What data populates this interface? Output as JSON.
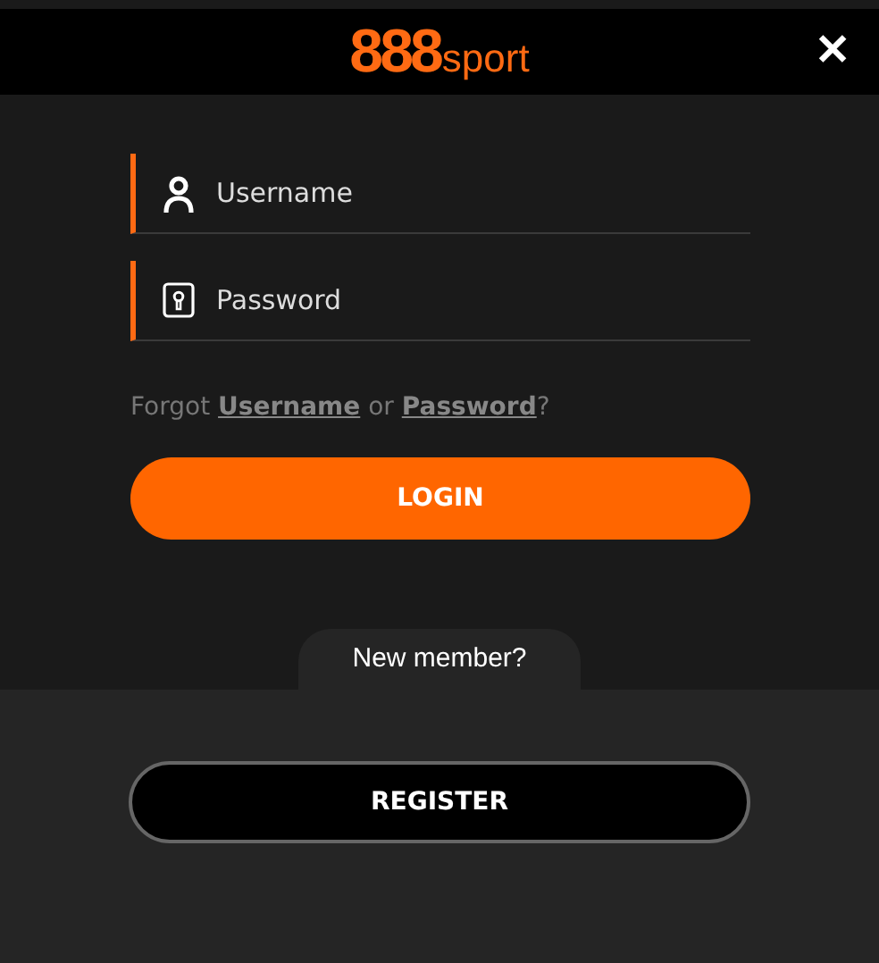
{
  "logo": {
    "main": "888",
    "suffix": "sport"
  },
  "close": {
    "label": "✕"
  },
  "fields": [
    {
      "kind": "user",
      "placeholder": "Username"
    },
    {
      "kind": "lock",
      "placeholder": "Password"
    }
  ],
  "forgot": [
    {
      "kind": "text",
      "text": "Forgot "
    },
    {
      "kind": "link",
      "text": "Username"
    },
    {
      "kind": "text",
      "text": " or "
    },
    {
      "kind": "link",
      "text": "Password"
    },
    {
      "kind": "text",
      "text": "?"
    }
  ],
  "login_button": "LOGIN",
  "new_member": "New member?",
  "register_button": "REGISTER"
}
